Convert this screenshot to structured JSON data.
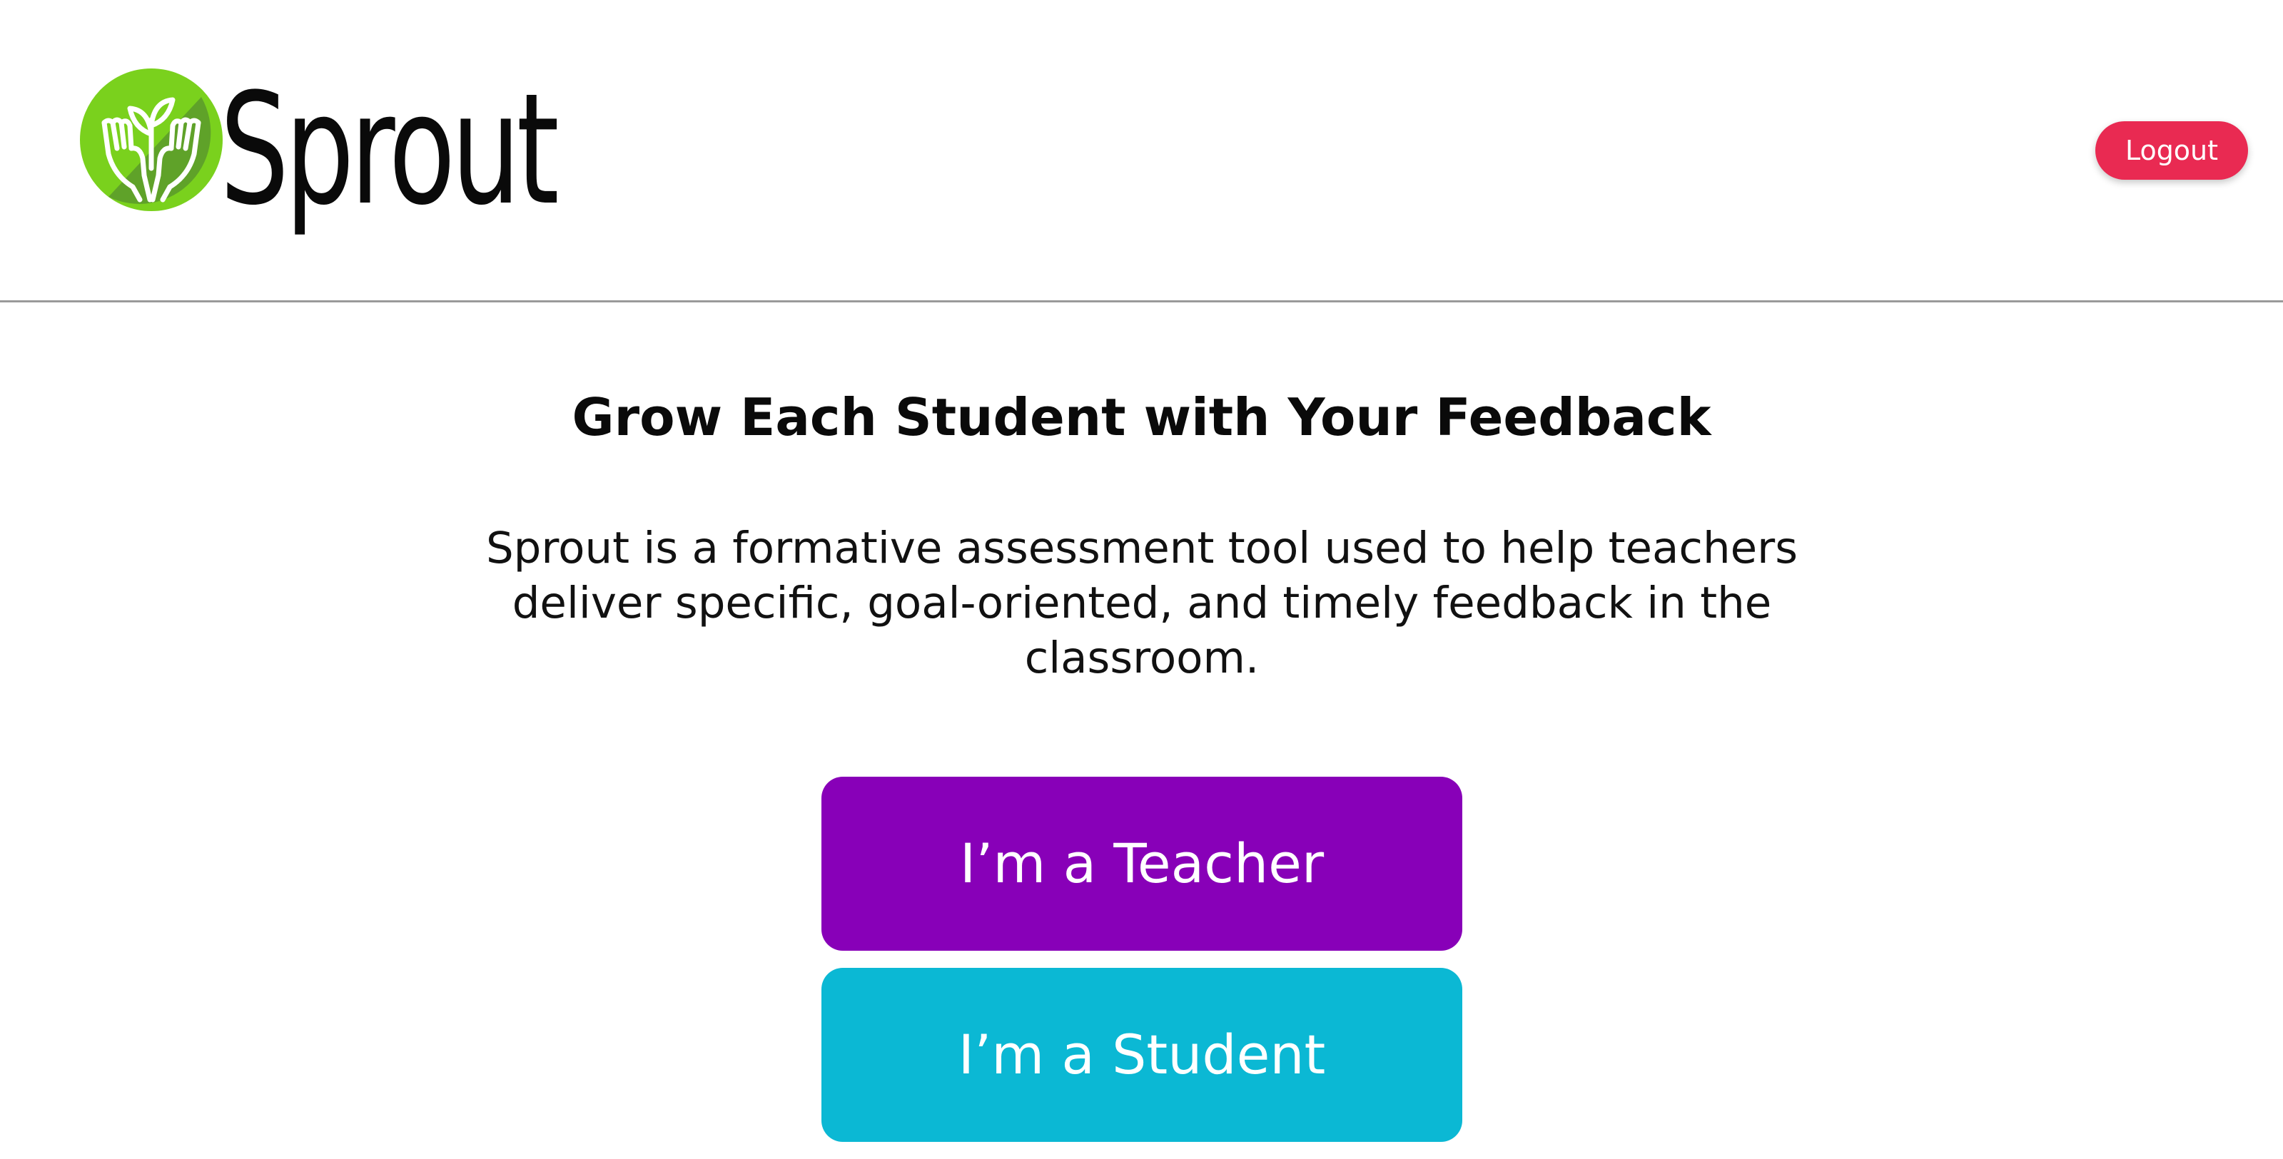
{
  "header": {
    "logo_text": "Sprout",
    "logout_label": "Logout"
  },
  "hero": {
    "title": "Grow Each Student with Your Feedback",
    "description": "Sprout is a formative assessment tool used to help teachers deliver specific, goal-oriented, and timely feedback in the classroom."
  },
  "roles": {
    "teacher_label": "I’m a Teacher",
    "student_label": "I’m a Student"
  },
  "colors": {
    "logout": "#e92a52",
    "teacher": "#8800b8",
    "student": "#0bb8d4",
    "logo_green_light": "#7ad11d",
    "logo_green_dark": "#5b9a2b"
  },
  "icons": {
    "logo": "hands-with-sprout-icon"
  }
}
